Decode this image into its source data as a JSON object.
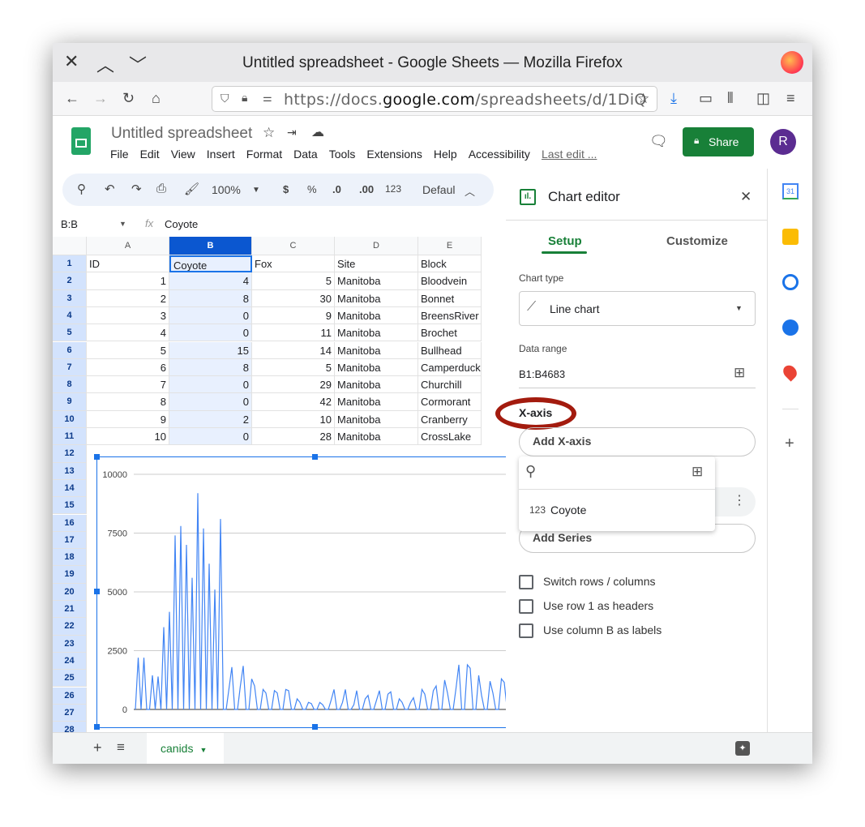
{
  "window": {
    "title": "Untitled spreadsheet - Google Sheets — Mozilla Firefox",
    "url_prefix": "https://docs.",
    "url_domain": "google.com",
    "url_rest": "/spreadsheets/d/1DiQ"
  },
  "doc": {
    "title": "Untitled spreadsheet",
    "share": "Share",
    "avatar": "R",
    "last_edit": "Last edit ...",
    "menu": [
      "File",
      "Edit",
      "View",
      "Insert",
      "Format",
      "Data",
      "Tools",
      "Extensions",
      "Help",
      "Accessibility"
    ]
  },
  "toolbar": {
    "zoom": "100%",
    "currency": "$",
    "percent": "%",
    "dec_less": ".0",
    "dec_more": ".00",
    "number_format": "123",
    "font": "Defaul"
  },
  "formula_bar": {
    "name_box": "B:B",
    "fx": "fx",
    "value": "Coyote"
  },
  "grid": {
    "columns": [
      "A",
      "B",
      "C",
      "D",
      "E"
    ],
    "rows": [
      [
        "ID",
        "Coyote",
        "Fox",
        "Site",
        "Block"
      ],
      [
        "1",
        "4",
        "5",
        "Manitoba",
        "Bloodvein"
      ],
      [
        "2",
        "8",
        "30",
        "Manitoba",
        "Bonnet"
      ],
      [
        "3",
        "0",
        "9",
        "Manitoba",
        "BreensRiver"
      ],
      [
        "4",
        "0",
        "11",
        "Manitoba",
        "Brochet"
      ],
      [
        "5",
        "15",
        "14",
        "Manitoba",
        "Bullhead"
      ],
      [
        "6",
        "8",
        "5",
        "Manitoba",
        "Camperduck"
      ],
      [
        "7",
        "0",
        "29",
        "Manitoba",
        "Churchill"
      ],
      [
        "8",
        "0",
        "42",
        "Manitoba",
        "Cormorant"
      ],
      [
        "9",
        "2",
        "10",
        "Manitoba",
        "Cranberry"
      ],
      [
        "10",
        "0",
        "28",
        "Manitoba",
        "CrossLake"
      ]
    ],
    "row_numbers": [
      "1",
      "2",
      "3",
      "4",
      "5",
      "6",
      "7",
      "8",
      "9",
      "10",
      "11",
      "12",
      "13",
      "14",
      "15",
      "16",
      "17",
      "18",
      "19",
      "20",
      "21",
      "22",
      "23",
      "24",
      "25",
      "26",
      "27",
      "28"
    ]
  },
  "sheet_tab": "canids",
  "chart_data": {
    "type": "line",
    "ylim": [
      0,
      10000
    ],
    "yticks": [
      "0",
      "2500",
      "5000",
      "7500",
      "10000"
    ],
    "grid": true,
    "series_color": "#4285f4",
    "values": [
      0,
      2200,
      0,
      2200,
      0,
      0,
      1450,
      0,
      1400,
      0,
      3500,
      0,
      4150,
      0,
      7400,
      0,
      7800,
      0,
      7000,
      0,
      5600,
      0,
      9200,
      0,
      7700,
      0,
      6200,
      0,
      5100,
      0,
      8100,
      0,
      0,
      900,
      1800,
      0,
      0,
      1000,
      1850,
      0,
      0,
      1300,
      1000,
      0,
      0,
      850,
      700,
      0,
      0,
      800,
      700,
      0,
      0,
      850,
      800,
      0,
      0,
      450,
      300,
      0,
      0,
      300,
      250,
      0,
      0,
      300,
      200,
      0,
      0,
      400,
      850,
      0,
      0,
      300,
      850,
      0,
      0,
      200,
      800,
      0,
      0,
      450,
      600,
      0,
      0,
      400,
      800,
      0,
      0,
      650,
      750,
      0,
      0,
      450,
      300,
      0,
      0,
      300,
      500,
      0,
      0,
      850,
      650,
      0,
      0,
      800,
      1000,
      0,
      0,
      1250,
      700,
      0,
      0,
      900,
      1900,
      0,
      0,
      1900,
      1750,
      0,
      0,
      1450,
      600,
      0,
      0,
      1200,
      700,
      0,
      0,
      1300,
      1150,
      0,
      0,
      1250,
      1700,
      0,
      0,
      1450,
      700,
      0,
      0,
      1000,
      400,
      0
    ]
  },
  "chart_editor": {
    "title": "Chart editor",
    "tabs": [
      "Setup",
      "Customize"
    ],
    "chart_type_label": "Chart type",
    "chart_type": "Line chart",
    "data_range_label": "Data range",
    "data_range": "B1:B4683",
    "x_axis_label": "X-axis",
    "add_x_axis": "Add X-axis",
    "dropdown_item_icon": "123",
    "dropdown_item": "Coyote",
    "add_series": "Add Series",
    "checkboxes": [
      "Switch rows / columns",
      "Use row 1 as headers",
      "Use column B as labels"
    ],
    "annotation_color": "#a31b0e"
  }
}
